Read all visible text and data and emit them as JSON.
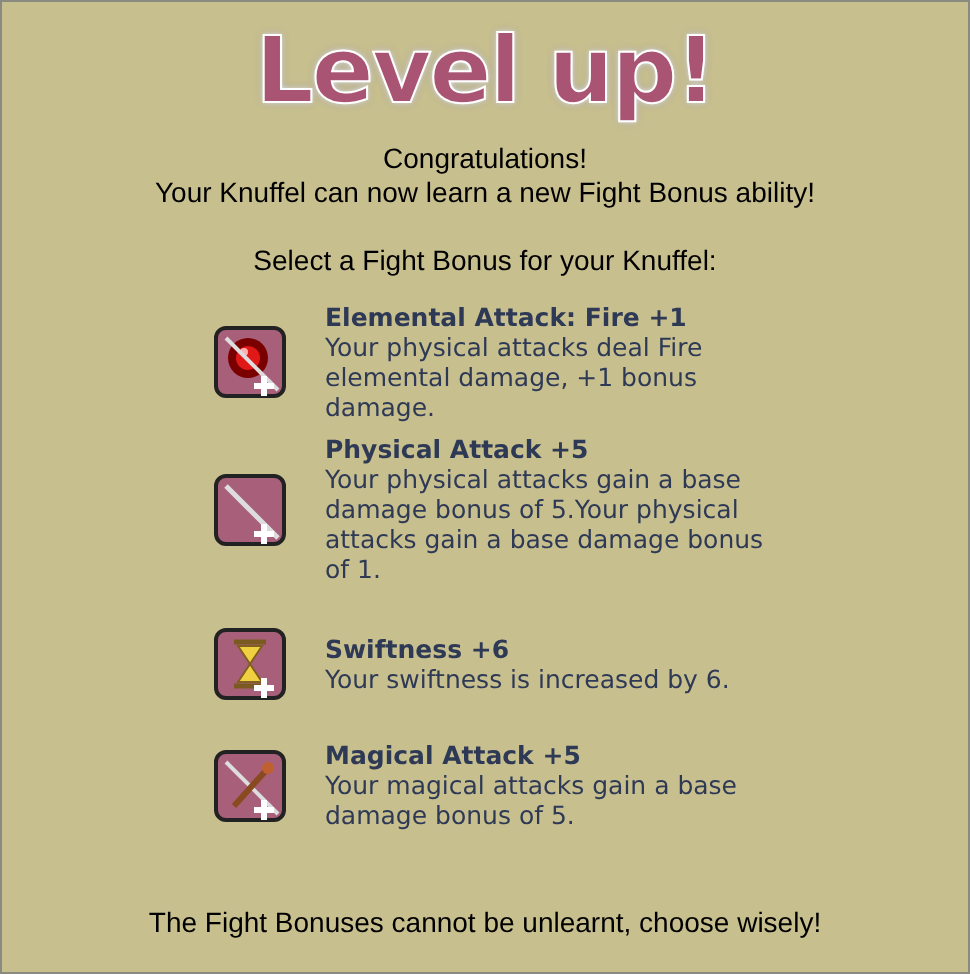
{
  "title": "Level up!",
  "intro": [
    "Congratulations!",
    "Your Knuffel can now learn a new Fight Bonus ability!"
  ],
  "prompt": "Select a Fight Bonus for your Knuffel:",
  "bonuses": [
    {
      "kind": "fire",
      "name": "Elemental Attack: Fire +1",
      "description": "Your physical attacks deal Fire elemental damage, +1 bonus damage."
    },
    {
      "kind": "physical",
      "name": "Physical Attack +5",
      "description": "Your physical attacks gain a base damage bonus of 5.Your physical attacks gain a base damage bonus of 1."
    },
    {
      "kind": "swiftness",
      "name": "Swiftness +6",
      "description": "Your swiftness is increased by 6."
    },
    {
      "kind": "magical",
      "name": "Magical Attack +5",
      "description": "Your magical attacks gain a base damage bonus of 5."
    }
  ],
  "footer": "The Fight Bonuses cannot be unlearnt, choose wisely!"
}
